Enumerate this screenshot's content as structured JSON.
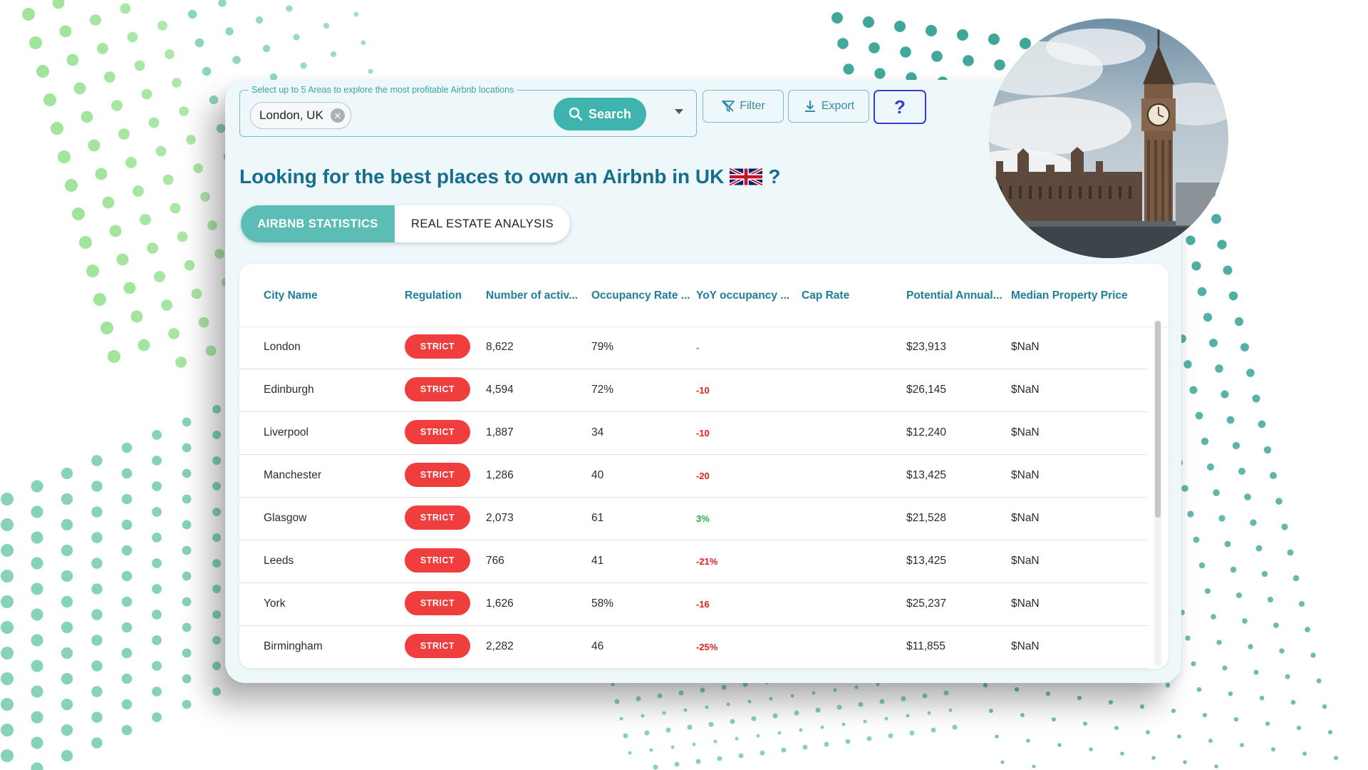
{
  "search": {
    "legend": "Select up to 5 Areas to explore the most profitable Airbnb locations",
    "chip_label": "London, UK",
    "button_label": "Search"
  },
  "toolbar": {
    "filter_label": "Filter",
    "export_label": "Export",
    "help_label": "?"
  },
  "headline": {
    "text": "Looking for the best places to own an Airbnb in UK",
    "suffix": "?"
  },
  "tabs": [
    {
      "label": "AIRBNB STATISTICS",
      "active": true
    },
    {
      "label": "REAL ESTATE ANALYSIS",
      "active": false
    }
  ],
  "table": {
    "columns": [
      "City Name",
      "Regulation",
      "Number of activ...",
      "Occupancy Rate ...",
      "YoY occupancy ...",
      "Cap Rate",
      "Potential Annual...",
      "Median Property Price"
    ],
    "rows": [
      {
        "city": "London",
        "regulation": "STRICT",
        "listings": "8,622",
        "occupancy": "79%",
        "yoy": "-",
        "yoy_trend": "neutral",
        "cap_rate": "",
        "revenue": "$23,913",
        "price": "$NaN"
      },
      {
        "city": "Edinburgh",
        "regulation": "STRICT",
        "listings": "4,594",
        "occupancy": "72%",
        "yoy": "-10",
        "yoy_trend": "negative",
        "cap_rate": "",
        "revenue": "$26,145",
        "price": "$NaN"
      },
      {
        "city": "Liverpool",
        "regulation": "STRICT",
        "listings": "1,887",
        "occupancy": "34",
        "yoy": "-10",
        "yoy_trend": "negative",
        "cap_rate": "",
        "revenue": "$12,240",
        "price": "$NaN"
      },
      {
        "city": "Manchester",
        "regulation": "STRICT",
        "listings": "1,286",
        "occupancy": "40",
        "yoy": "-20",
        "yoy_trend": "negative",
        "cap_rate": "",
        "revenue": "$13,425",
        "price": "$NaN"
      },
      {
        "city": "Glasgow",
        "regulation": "STRICT",
        "listings": "2,073",
        "occupancy": "61",
        "yoy": "3%",
        "yoy_trend": "positive",
        "cap_rate": "",
        "revenue": "$21,528",
        "price": "$NaN"
      },
      {
        "city": "Leeds",
        "regulation": "STRICT",
        "listings": "766",
        "occupancy": "41",
        "yoy": "-21%",
        "yoy_trend": "negative",
        "cap_rate": "",
        "revenue": "$13,425",
        "price": "$NaN"
      },
      {
        "city": "York",
        "regulation": "STRICT",
        "listings": "1,626",
        "occupancy": "58%",
        "yoy": "-16",
        "yoy_trend": "negative",
        "cap_rate": "",
        "revenue": "$25,237",
        "price": "$NaN"
      },
      {
        "city": "Birmingham",
        "regulation": "STRICT",
        "listings": "2,282",
        "occupancy": "46",
        "yoy": "-25%",
        "yoy_trend": "negative",
        "cap_rate": "",
        "revenue": "$11,855",
        "price": "$NaN"
      }
    ]
  },
  "colors": {
    "accent": "#3fb3ad",
    "heading": "#156f8c",
    "strict_badge": "#f03d3d",
    "dot_pattern": "#5ec4a0",
    "help_border": "#3a3ad8"
  },
  "icons": {
    "search": "magnifier-icon",
    "filter": "filter-off-icon",
    "export": "download-icon",
    "chip_remove": "close-circle-icon",
    "dropdown": "caret-down-icon",
    "flag": "uk-flag-icon"
  }
}
